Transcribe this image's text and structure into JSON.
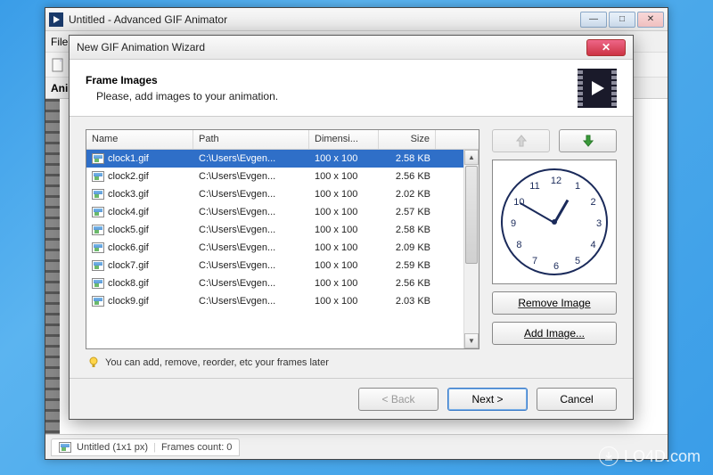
{
  "main_window": {
    "title": "Untitled - Advanced GIF Animator",
    "menu_file": "File",
    "tab_label": "Anima",
    "status_title": "Untitled (1x1 px)",
    "status_frames": "Frames count: 0"
  },
  "dialog": {
    "title": "New GIF Animation Wizard",
    "heading": "Frame Images",
    "subheading": "Please, add images to your animation.",
    "columns": {
      "name": "Name",
      "path": "Path",
      "dim": "Dimensi...",
      "size": "Size"
    },
    "files": [
      {
        "name": "clock1.gif",
        "path": "C:\\Users\\Evgen...",
        "dim": "100 x 100",
        "size": "2.58 KB",
        "selected": true
      },
      {
        "name": "clock2.gif",
        "path": "C:\\Users\\Evgen...",
        "dim": "100 x 100",
        "size": "2.56 KB",
        "selected": false
      },
      {
        "name": "clock3.gif",
        "path": "C:\\Users\\Evgen...",
        "dim": "100 x 100",
        "size": "2.02 KB",
        "selected": false
      },
      {
        "name": "clock4.gif",
        "path": "C:\\Users\\Evgen...",
        "dim": "100 x 100",
        "size": "2.57 KB",
        "selected": false
      },
      {
        "name": "clock5.gif",
        "path": "C:\\Users\\Evgen...",
        "dim": "100 x 100",
        "size": "2.58 KB",
        "selected": false
      },
      {
        "name": "clock6.gif",
        "path": "C:\\Users\\Evgen...",
        "dim": "100 x 100",
        "size": "2.09 KB",
        "selected": false
      },
      {
        "name": "clock7.gif",
        "path": "C:\\Users\\Evgen...",
        "dim": "100 x 100",
        "size": "2.59 KB",
        "selected": false
      },
      {
        "name": "clock8.gif",
        "path": "C:\\Users\\Evgen...",
        "dim": "100 x 100",
        "size": "2.56 KB",
        "selected": false
      },
      {
        "name": "clock9.gif",
        "path": "C:\\Users\\Evgen...",
        "dim": "100 x 100",
        "size": "2.03 KB",
        "selected": false
      }
    ],
    "hint": "You can add, remove, reorder, etc your frames later",
    "buttons": {
      "remove": "Remove Image",
      "add": "Add Image...",
      "back": "< Back",
      "next": "Next >",
      "cancel": "Cancel"
    },
    "preview_clock": {
      "numbers": [
        "12",
        "1",
        "2",
        "3",
        "4",
        "5",
        "6",
        "7",
        "8",
        "9",
        "10",
        "11"
      ],
      "hour_angle": -60,
      "minute_angle": 210
    }
  },
  "watermark": "LO4D.com"
}
